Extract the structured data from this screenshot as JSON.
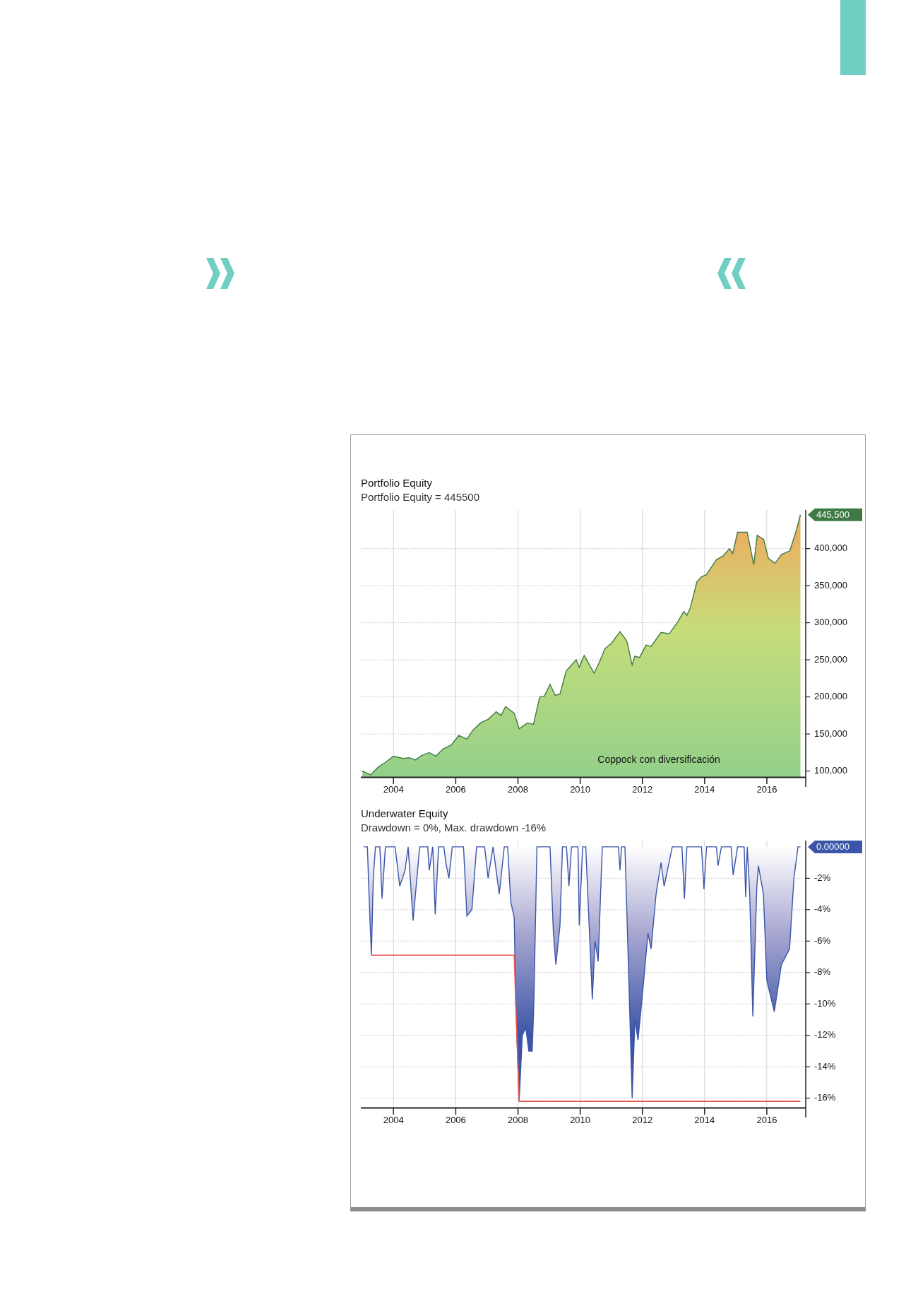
{
  "charts": [
    {
      "legend": "Portfolio Equity = 445500",
      "value_flag": "445,500",
      "chart_data": {
        "type": "area",
        "title": "Portfolio Equity",
        "grid": true,
        "xlim": [
          2002.95,
          2017.25
        ],
        "ylim": [
          92000,
          452000
        ],
        "xticks": [
          2004,
          2006,
          2008,
          2010,
          2012,
          2014,
          2016
        ],
        "yticks": [
          {
            "value": 100000,
            "label": "100,000"
          },
          {
            "value": 150000,
            "label": "150,000"
          },
          {
            "value": 200000,
            "label": "200,000"
          },
          {
            "value": 250000,
            "label": "250,000"
          },
          {
            "value": 300000,
            "label": "300,000"
          },
          {
            "value": 350000,
            "label": "350,000"
          },
          {
            "value": 400000,
            "label": "400,000"
          }
        ],
        "x": [
          2003.0,
          2003.1,
          2003.27,
          2003.5,
          2003.75,
          2004.0,
          2004.3,
          2004.5,
          2004.7,
          2004.9,
          2005.15,
          2005.36,
          2005.6,
          2005.85,
          2006.1,
          2006.36,
          2006.55,
          2006.8,
          2007.05,
          2007.3,
          2007.46,
          2007.6,
          2007.88,
          2008.04,
          2008.3,
          2008.5,
          2008.7,
          2008.85,
          2009.03,
          2009.2,
          2009.35,
          2009.55,
          2009.87,
          2009.97,
          2010.13,
          2010.45,
          2010.6,
          2010.8,
          2011.0,
          2011.28,
          2011.5,
          2011.67,
          2011.76,
          2011.91,
          2012.12,
          2012.28,
          2012.6,
          2012.86,
          2013.12,
          2013.33,
          2013.43,
          2013.54,
          2013.75,
          2013.9,
          2014.06,
          2014.38,
          2014.59,
          2014.8,
          2014.9,
          2015.06,
          2015.37,
          2015.58,
          2015.69,
          2015.9,
          2016.05,
          2016.26,
          2016.47,
          2016.74,
          2016.95,
          2017.08
        ],
        "series": [
          {
            "color": "#3f7a45",
            "values": [
              100000,
              98000,
              95000,
              105000,
              112000,
              120000,
              117000,
              118000,
              115000,
              121000,
              125000,
              120000,
              130000,
              135000,
              148000,
              143000,
              155000,
              165000,
              170000,
              180000,
              175000,
              187000,
              178000,
              157000,
              165000,
              163000,
              200000,
              201000,
              217000,
              202000,
              204000,
              235000,
              250000,
              240000,
              256000,
              232000,
              245000,
              265000,
              272000,
              288000,
              275000,
              243000,
              255000,
              253000,
              270000,
              268000,
              287000,
              285000,
              300000,
              315000,
              310000,
              320000,
              355000,
              362000,
              365000,
              385000,
              390000,
              400000,
              393000,
              422000,
              422000,
              378000,
              418000,
              412000,
              387000,
              380000,
              392000,
              397000,
              425000,
              445500
            ]
          }
        ],
        "annotations": [
          "Coppock con diversificación"
        ]
      }
    },
    {
      "legend": "Drawdown = 0%, Max. drawdown -16%",
      "value_flag": "0.00000",
      "chart_data": {
        "type": "area",
        "title": "Underwater Equity",
        "grid": true,
        "xlim": [
          2002.95,
          2017.25
        ],
        "ylim": [
          -16.6,
          0.4
        ],
        "xticks": [
          2004,
          2006,
          2008,
          2010,
          2012,
          2014,
          2016
        ],
        "yticks": [
          {
            "value": -2,
            "label": "-2%"
          },
          {
            "value": -4,
            "label": "-4%"
          },
          {
            "value": -6,
            "label": "-6%"
          },
          {
            "value": -8,
            "label": "-8%"
          },
          {
            "value": -10,
            "label": "-10%"
          },
          {
            "value": -12,
            "label": "-12%"
          },
          {
            "value": -14,
            "label": "-14%"
          },
          {
            "value": -16,
            "label": "-16%"
          }
        ],
        "x": [
          2003.04,
          2003.16,
          2003.22,
          2003.29,
          2003.35,
          2003.42,
          2003.56,
          2003.63,
          2003.74,
          2004.05,
          2004.2,
          2004.37,
          2004.47,
          2004.63,
          2004.84,
          2005.1,
          2005.15,
          2005.26,
          2005.34,
          2005.45,
          2005.62,
          2005.68,
          2005.78,
          2005.89,
          2006.25,
          2006.36,
          2006.52,
          2006.67,
          2006.93,
          2007.04,
          2007.2,
          2007.4,
          2007.56,
          2007.67,
          2007.77,
          2007.88,
          2007.93,
          2008.04,
          2008.14,
          2008.25,
          2008.35,
          2008.46,
          2008.51,
          2008.61,
          2009.03,
          2009.14,
          2009.22,
          2009.35,
          2009.43,
          2009.56,
          2009.64,
          2009.72,
          2009.93,
          2009.97,
          2010.08,
          2010.18,
          2010.39,
          2010.48,
          2010.58,
          2010.71,
          2011.23,
          2011.28,
          2011.33,
          2011.44,
          2011.6,
          2011.67,
          2011.76,
          2011.86,
          2012.02,
          2012.18,
          2012.28,
          2012.44,
          2012.6,
          2012.7,
          2012.96,
          2013.27,
          2013.35,
          2013.43,
          2013.9,
          2013.98,
          2014.06,
          2014.38,
          2014.43,
          2014.54,
          2014.85,
          2014.92,
          2015.06,
          2015.27,
          2015.32,
          2015.37,
          2015.45,
          2015.55,
          2015.68,
          2015.73,
          2015.89,
          2016.0,
          2016.24,
          2016.47,
          2016.73,
          2016.87,
          2017.0,
          2017.08
        ],
        "series": [
          {
            "color": "#3b55a8",
            "values": [
              0,
              0,
              -3.5,
              -6.9,
              -2,
              0,
              0,
              -3.3,
              0,
              0,
              -2.5,
              -1.5,
              0,
              -4.7,
              0,
              0,
              -1.5,
              0,
              -4.3,
              0,
              0,
              -1,
              -2,
              0,
              0,
              -4.4,
              -4,
              0,
              0,
              -2,
              0,
              -3,
              0,
              0,
              -3.5,
              -4.5,
              -10,
              -16.2,
              -12,
              -11.5,
              -13,
              -13,
              -10,
              0,
              0,
              -5.5,
              -7.5,
              -5,
              0,
              0,
              -2.5,
              0,
              0,
              -5,
              0,
              0,
              -9.7,
              -6,
              -7.3,
              0,
              0,
              -1.5,
              0,
              0,
              -11,
              -16,
              -11,
              -12.3,
              -9,
              -5.5,
              -6.5,
              -3,
              -1,
              -2.5,
              0,
              0,
              -3.3,
              0,
              0,
              -2.7,
              0,
              0,
              -1.2,
              0,
              0,
              -1.8,
              0,
              0,
              -3.2,
              0,
              -3,
              -10.8,
              -2.5,
              -1.2,
              -3,
              -8.5,
              -10.5,
              -7.5,
              -6.5,
              -2,
              0,
              0
            ]
          },
          {
            "type": "line",
            "color": "#e8574f",
            "values": [
              null,
              null,
              null,
              -6.9,
              -6.9,
              -6.9,
              -6.9,
              -6.9,
              -6.9,
              -6.9,
              -6.9,
              -6.9,
              -6.9,
              -6.9,
              -6.9,
              -6.9,
              -6.9,
              -6.9,
              -6.9,
              -6.9,
              -6.9,
              -6.9,
              -6.9,
              -6.9,
              -6.9,
              -6.9,
              -6.9,
              -6.9,
              -6.9,
              -6.9,
              -6.9,
              -6.9,
              -6.9,
              -6.9,
              -6.9,
              -6.9,
              -10,
              -16.2,
              -16.2,
              -16.2,
              -16.2,
              -16.2,
              -16.2,
              -16.2,
              -16.2,
              -16.2,
              -16.2,
              -16.2,
              -16.2,
              -16.2,
              -16.2,
              -16.2,
              -16.2,
              -16.2,
              -16.2,
              -16.2,
              -16.2,
              -16.2,
              -16.2,
              -16.2,
              -16.2,
              -16.2,
              -16.2,
              -16.2,
              -16.2,
              -16.2,
              -16.2,
              -16.2,
              -16.2,
              -16.2,
              -16.2,
              -16.2,
              -16.2,
              -16.2,
              -16.2,
              -16.2,
              -16.2,
              -16.2,
              -16.2,
              -16.2,
              -16.2,
              -16.2,
              -16.2,
              -16.2,
              -16.2,
              -16.2,
              -16.2,
              -16.2,
              -16.2,
              -16.2,
              -16.2,
              -16.2,
              -16.2,
              -16.2,
              -16.2,
              -16.2,
              -16.2,
              -16.2,
              -16.2,
              -16.2,
              -16.2,
              -16.2
            ]
          }
        ]
      }
    }
  ]
}
